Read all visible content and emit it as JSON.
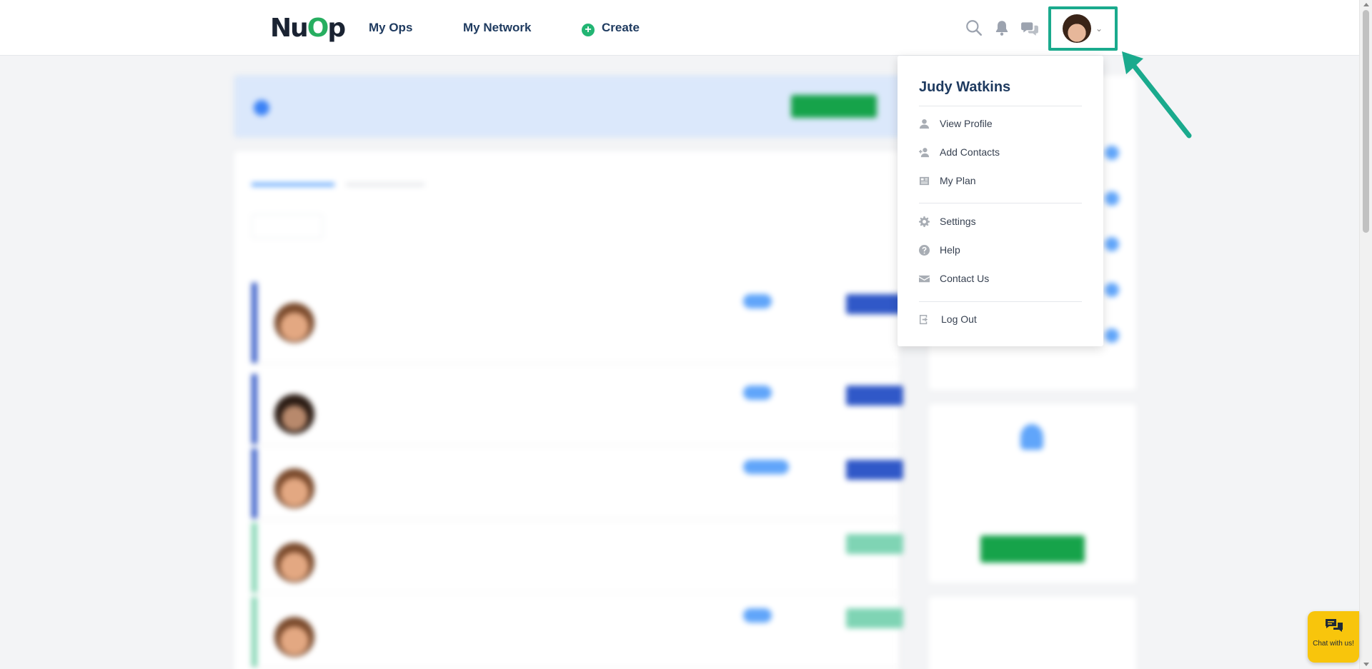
{
  "header": {
    "logo": "NuOp",
    "nav": [
      "My Ops",
      "My Network"
    ],
    "create": "Create"
  },
  "menu": {
    "user_name": "Judy Watkins",
    "items": {
      "view_profile": "View Profile",
      "add_contacts": "Add Contacts",
      "my_plan": "My Plan",
      "settings": "Settings",
      "help": "Help",
      "contact_us": "Contact Us",
      "log_out": "Log Out"
    }
  },
  "chat": {
    "label": "Chat with us!"
  },
  "colors": {
    "accent_teal": "#1aaa8d",
    "brand_green": "#22b573",
    "nav_text": "#1e3a5f",
    "chat_yellow": "#f8c50c"
  },
  "icons": {
    "header": [
      "search-icon",
      "bell-icon",
      "chat-bubbles-icon",
      "avatar",
      "chevron-down-icon"
    ],
    "menu": [
      "user-icon",
      "add-user-icon",
      "plan-icon",
      "gear-icon",
      "help-icon",
      "envelope-icon",
      "logout-icon"
    ]
  }
}
